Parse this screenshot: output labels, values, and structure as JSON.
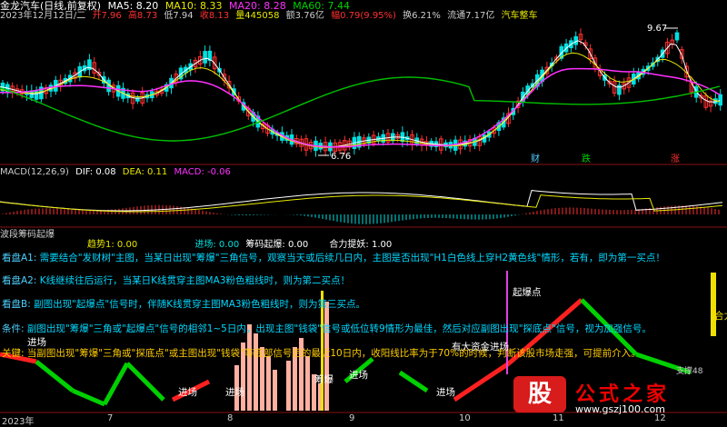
{
  "header": {
    "title": "金龙汽车(日线,前复权)",
    "ma5": "MA5: 8.20",
    "ma10": "MA10: 8.33",
    "ma20": "MA20: 8.28",
    "ma60": "MA60: 7.44",
    "quote": {
      "date": "2023年12月12日/二",
      "open": "开7.96",
      "high": "高8.73",
      "low": "低7.94",
      "close": "收8.13",
      "volume": "量445058",
      "amount": "额3.76亿",
      "change": "幅0.79(9.95%)",
      "turnover": "换6.21%",
      "float": "流通7.17亿",
      "sector": "汽车整车"
    }
  },
  "main_labels": {
    "high": "9.67",
    "low": "6.76",
    "cai": "财",
    "die": "跌",
    "zhang": "涨"
  },
  "macd": {
    "title": "MACD(12,26,9)",
    "dif": "DIF: 0.08",
    "dea": "DEA: 0.11",
    "macd": "MACD: -0.06"
  },
  "indicator": {
    "title": "波段筹码起爆",
    "trend": "趋势1: 0.00",
    "enter": "进场: 0.00",
    "chip": "筹码起爆: 0.00",
    "force": "合力提妖: 1.00",
    "notes": [
      {
        "key": "看盘A1:",
        "text": "需要结合\"发财树\"主图，当某日出现\"筹爆\"三角信号，观察当天或后续几日内，主图是否出现\"H1白色线上穿H2黄色线\"情形，若有，即为第一买点！"
      },
      {
        "key": "看盘A2:",
        "text": "K线继续往后运行，当某日K线贯穿主图MA3粉色粗线时，则为第二买点！"
      },
      {
        "key": "看盘B:",
        "text": "副图出现\"起爆点\"信号时，伴随K线贯穿主图MA3粉色粗线时，则为第三买点。"
      },
      {
        "key": "条件:",
        "text": "副图出现\"筹爆\"三角或\"起爆点\"信号的相邻1~5日内，出现主图\"钱袋\"信号或低位转9情形为最佳，然后对应副图出现\"探底点\"信号，视为加强信号。"
      },
      {
        "key": "关键:",
        "text": "当副图出现\"筹爆\"三角或\"探底点\"或主图出现\"钱袋\"等底部信号后的最近10日内，收阳线比率为于70%的时候，判断该股市场走强，可提前介入。"
      }
    ],
    "tags": {
      "enter": "进场",
      "chouBao": "筹爆",
      "qiBao": "起爆点",
      "heLi": "合力",
      "youZiJin": "有大资金进场",
      "bottom": "支撑48"
    }
  },
  "axis": {
    "year": "2023年",
    "m7": "7",
    "m8": "8",
    "m9": "9",
    "m10": "10",
    "m11": "11",
    "m12": "12"
  },
  "brand": {
    "badge": "股",
    "name": "公式之家",
    "url": "www.gszj100.com"
  },
  "colors": {
    "up": "#ff3030",
    "down": "#00e0e0",
    "ma5": "#ffffff",
    "ma10": "#e8e800",
    "ma20": "#ff30ff",
    "ma60": "#00c000",
    "green": "#00d000",
    "red": "#ff2020"
  },
  "chart_data": {
    "type": "candlestick",
    "x": [
      "2023-07",
      "2023-08",
      "2023-09",
      "2023-10",
      "2023-11",
      "2023-12"
    ],
    "high": 9.67,
    "low": 6.76,
    "last_close": 8.13
  }
}
